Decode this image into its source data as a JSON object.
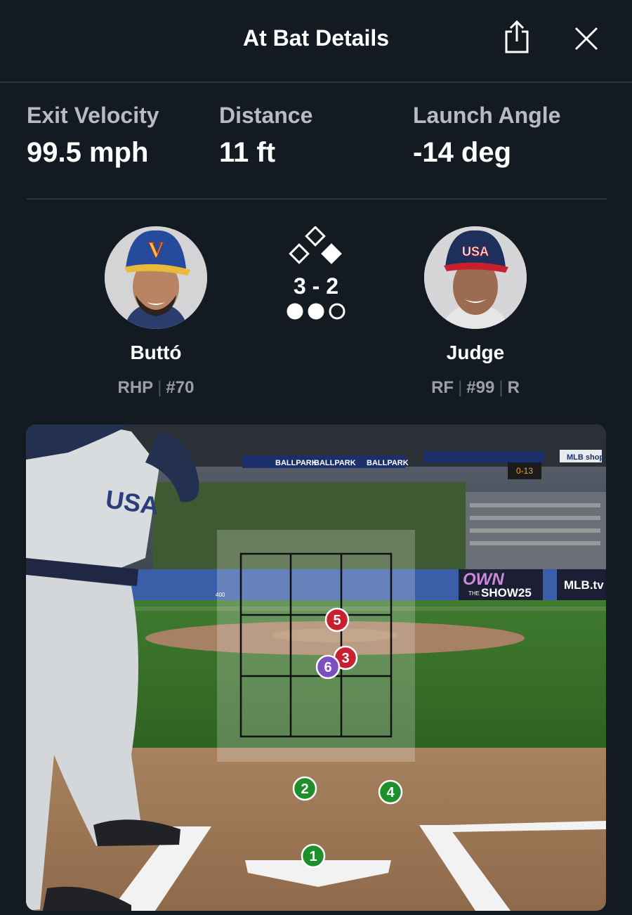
{
  "header": {
    "title": "At Bat Details"
  },
  "stats": [
    {
      "label": "Exit Velocity",
      "value": "99.5 mph"
    },
    {
      "label": "Distance",
      "value": "11 ft"
    },
    {
      "label": "Launch Angle",
      "value": "-14 deg"
    }
  ],
  "pitcher": {
    "name": "Buttó",
    "position": "RHP",
    "number": "#70",
    "cap_letter": "V"
  },
  "batter": {
    "name": "Judge",
    "position": "RF",
    "number": "#99",
    "bats": "R",
    "cap_letter": "USA"
  },
  "count": {
    "text": "3 - 2",
    "outs": 2,
    "outs_total": 3
  },
  "field_signs": {
    "ballpark_banner": "BALLPARK",
    "mlb_shop": "MLB shop",
    "own_the_show_top": "OWN",
    "own_the_show_mid": "THE",
    "own_the_show_bottom": "SHOW25",
    "mlb_tv": "MLB.tv",
    "jersey": "USA",
    "wall_distance": "400",
    "scoreboard": "0-13"
  },
  "pitches": [
    {
      "number": "1",
      "result": "ball",
      "color": "#1f8f2e"
    },
    {
      "number": "2",
      "result": "ball",
      "color": "#1f8f2e"
    },
    {
      "number": "3",
      "result": "strike",
      "color": "#c8202f"
    },
    {
      "number": "4",
      "result": "ball",
      "color": "#1f8f2e"
    },
    {
      "number": "5",
      "result": "strike",
      "color": "#c8202f"
    },
    {
      "number": "6",
      "result": "in-play",
      "color": "#7b4fbf"
    }
  ]
}
